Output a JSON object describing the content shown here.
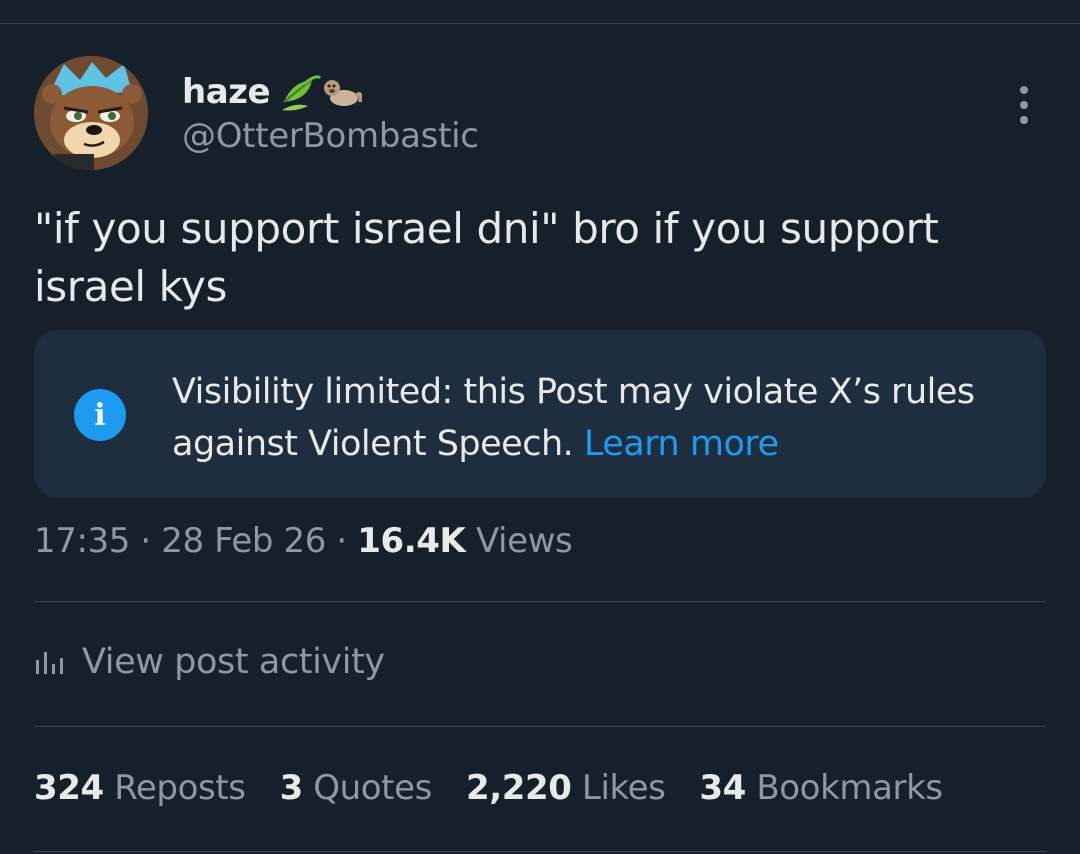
{
  "author": {
    "display_name": "haze",
    "name_emojis": [
      "leaf-fluttering-icon",
      "otter-icon"
    ],
    "handle": "@OtterBombastic"
  },
  "post": {
    "text": "\"if you support israel dni\" bro if you support israel kys"
  },
  "notice": {
    "text": "Visibility limited: this Post may violate X’s rules against Violent Speech.",
    "link_label": "Learn more"
  },
  "meta": {
    "time": "17:35",
    "date": "28 Feb 26",
    "separator": "·",
    "views_count": "16.4K",
    "views_label": "Views"
  },
  "activity": {
    "label": "View post activity"
  },
  "stats": {
    "reposts_count": "324",
    "reposts_label": "Reposts",
    "quotes_count": "3",
    "quotes_label": "Quotes",
    "likes_count": "2,220",
    "likes_label": "Likes",
    "bookmarks_count": "34",
    "bookmarks_label": "Bookmarks"
  },
  "colors": {
    "background": "#15202b",
    "text_primary": "#e7e9ea",
    "text_secondary": "#8b98a5",
    "accent": "#1d9bf0",
    "notice_bg": "#1e2e3e",
    "divider": "#38444d"
  }
}
